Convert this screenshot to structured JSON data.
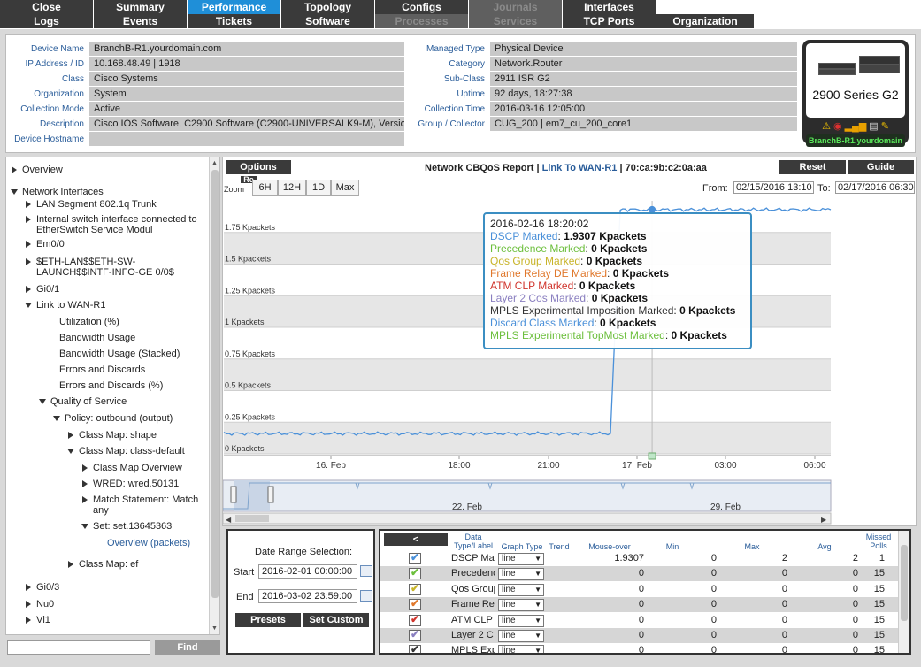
{
  "nav": {
    "row1": [
      {
        "label": "Close",
        "state": "normal"
      },
      {
        "label": "Summary",
        "state": "normal"
      },
      {
        "label": "Performance",
        "state": "active"
      },
      {
        "label": "Topology",
        "state": "normal"
      },
      {
        "label": "Configs",
        "state": "normal"
      },
      {
        "label": "Journals",
        "state": "disabled"
      },
      {
        "label": "Interfaces",
        "state": "normal"
      }
    ],
    "row2": [
      {
        "label": "Logs",
        "state": "normal"
      },
      {
        "label": "Events",
        "state": "normal"
      },
      {
        "label": "Tickets",
        "state": "normal"
      },
      {
        "label": "Software",
        "state": "normal"
      },
      {
        "label": "Processes",
        "state": "disabled"
      },
      {
        "label": "Services",
        "state": "disabled"
      },
      {
        "label": "TCP Ports",
        "state": "normal"
      },
      {
        "label": "Organization",
        "state": "normal"
      }
    ]
  },
  "device": {
    "left": [
      {
        "label": "Device Name",
        "value": "BranchB-R1.yourdomain.com"
      },
      {
        "label": "IP Address / ID",
        "value": "10.168.48.49 | 1918"
      },
      {
        "label": "Class",
        "value": "Cisco Systems"
      },
      {
        "label": "Organization",
        "value": "System"
      },
      {
        "label": "Collection Mode",
        "value": "Active"
      },
      {
        "label": "Description",
        "value": "Cisco IOS Software, C2900 Software (C2900-UNIVERSALK9-M), Version"
      },
      {
        "label": "Device Hostname",
        "value": ""
      }
    ],
    "right": [
      {
        "label": "Managed Type",
        "value": "Physical Device"
      },
      {
        "label": "Category",
        "value": "Network.Router"
      },
      {
        "label": "Sub-Class",
        "value": "2911 ISR G2"
      },
      {
        "label": "Uptime",
        "value": "92 days, 18:27:38"
      },
      {
        "label": "Collection Time",
        "value": "2016-03-16 12:05:00"
      },
      {
        "label": "Group / Collector",
        "value": "CUG_200 | em7_cu_200_core1"
      }
    ],
    "card": {
      "series": "2900 Series G2",
      "name": "BranchB-R1.yourdomain",
      "icons": [
        "warning-icon",
        "lifebuoy-icon",
        "signal-bars-icon",
        "printer-icon",
        "wrench-icon"
      ]
    }
  },
  "tree": {
    "find_label": "Find",
    "items": [
      {
        "label": "Overview",
        "expander": "right"
      },
      {
        "label": "Network Interfaces",
        "expander": "down"
      },
      {
        "label": "LAN Segment 802.1q Trunk",
        "expander": "right"
      },
      {
        "label": "Internal switch interface connected to",
        "label2": "EtherSwitch Service Modul",
        "expander": "right"
      },
      {
        "label": "Em0/0",
        "expander": "right"
      },
      {
        "label": "$ETH-LAN$$ETH-SW-",
        "label2": "LAUNCH$$INTF-INFO-GE 0/0$",
        "expander": "right"
      },
      {
        "label": "Gi0/1",
        "expander": "right"
      },
      {
        "label": "Link to WAN-R1",
        "expander": "down"
      },
      {
        "label": "Utilization (%)",
        "expander": "none"
      },
      {
        "label": "Bandwidth Usage",
        "expander": "none"
      },
      {
        "label": "Bandwidth Usage (Stacked)",
        "expander": "none"
      },
      {
        "label": "Errors and Discards",
        "expander": "none"
      },
      {
        "label": "Errors and Discards (%)",
        "expander": "none"
      },
      {
        "label": "Quality of Service",
        "expander": "down"
      },
      {
        "label": "Policy: outbound (output)",
        "expander": "down"
      },
      {
        "label": "Class Map: shape",
        "expander": "right"
      },
      {
        "label": "Class Map: class-default",
        "expander": "down"
      },
      {
        "label": "Class Map Overview",
        "expander": "right"
      },
      {
        "label": "WRED: wred.50131",
        "expander": "right"
      },
      {
        "label": "Match Statement: Match",
        "label2": "any",
        "expander": "right"
      },
      {
        "label": "Set: set.13645363",
        "expander": "down"
      },
      {
        "label": "Overview (packets)",
        "expander": "none"
      },
      {
        "label": "Class Map: ef",
        "expander": "right"
      },
      {
        "label": "Gi0/3",
        "expander": "right"
      },
      {
        "label": "Nu0",
        "expander": "right"
      },
      {
        "label": "Vl1",
        "expander": "right"
      }
    ]
  },
  "chart": {
    "options_label": "Options",
    "reset_label": "Reset",
    "guide_label": "Guide",
    "title_prefix": "Network CBQoS Report | ",
    "title_link": "Link To WAN-R1",
    "title_suffix": " | 70:ca:9b:c2:0a:aa",
    "zoom_label": "Zoom",
    "overlap_label": "Re",
    "zoom_buttons": [
      "6H",
      "12H",
      "1D",
      "Max"
    ],
    "from_label": "From:",
    "from_value": "02/15/2016 13:10",
    "to_label": "To:",
    "to_value": "02/17/2016 06:30",
    "navigator_ticks": [
      "22. Feb",
      "29. Feb"
    ]
  },
  "chart_data": {
    "type": "line",
    "ylabel_unit": "Kpackets",
    "y_ticks": [
      "0 Kpackets",
      "0.25 Kpackets",
      "0.5 Kpackets",
      "0.75 Kpackets",
      "1 Kpackets",
      "1.25 Kpackets",
      "1.5 Kpackets",
      "1.75 Kpackets"
    ],
    "x_ticks": [
      "16. Feb",
      "18:00",
      "21:00",
      "17. Feb",
      "03:00",
      "06:00"
    ],
    "ylim": [
      0,
      2
    ],
    "grid": true,
    "series": [
      {
        "name": "DSCP Marked",
        "color": "#4a90d9",
        "x": [
          "2016-02-15 13:10",
          "2016-02-15 18:00",
          "2016-02-16 00:00",
          "2016-02-16 06:00",
          "2016-02-16 12:00",
          "2016-02-16 15:30",
          "2016-02-16 16:00",
          "2016-02-16 16:10",
          "2016-02-16 17:00",
          "2016-02-16 18:20",
          "2016-02-16 21:00",
          "2016-02-17 00:00",
          "2016-02-17 03:00",
          "2016-02-17 06:30"
        ],
        "values": [
          0.16,
          0.16,
          0.16,
          0.16,
          0.16,
          0.16,
          1.5,
          1.93,
          1.93,
          1.9307,
          1.93,
          1.93,
          1.93,
          1.93
        ]
      }
    ]
  },
  "tooltip": {
    "time": "2016-02-16 18:20:02",
    "rows": [
      {
        "name": "DSCP Marked",
        "value": "1.9307 Kpackets",
        "color": "#4a90d9"
      },
      {
        "name": "Precedence Marked",
        "value": "0 Kpackets",
        "color": "#6cbf3c"
      },
      {
        "name": "Qos Group Marked",
        "value": "0 Kpackets",
        "color": "#c8b428"
      },
      {
        "name": "Frame Relay DE Marked",
        "value": "0 Kpackets",
        "color": "#e0782c"
      },
      {
        "name": "ATM CLP Marked",
        "value": "0 Kpackets",
        "color": "#d0342c"
      },
      {
        "name": "Layer 2 Cos Marked",
        "value": "0 Kpackets",
        "color": "#8a7fc0"
      },
      {
        "name": "MPLS Experimental Imposition Marked",
        "value": "0 Kpackets",
        "color": "#333333"
      },
      {
        "name": "Discard Class Marked",
        "value": "0 Kpackets",
        "color": "#4a90d9"
      },
      {
        "name": "MPLS Experimental TopMost Marked",
        "value": "0 Kpackets",
        "color": "#6cbf3c"
      }
    ]
  },
  "daterange": {
    "title": "Date Range Selection:",
    "start_label": "Start",
    "start_value": "2016-02-01 00:00:00",
    "end_label": "End",
    "end_value": "2016-03-02 23:59:00",
    "presets_label": "Presets",
    "setcustom_label": "Set Custom"
  },
  "table": {
    "back_label": "<",
    "headers": {
      "datatype": "Data Type/Label",
      "graphtype": "Graph Type",
      "trend": "Trend",
      "mouseover": "Mouse-over",
      "min": "Min",
      "max": "Max",
      "avg": "Avg",
      "missed": "Missed Polls"
    },
    "rows": [
      {
        "label": "DSCP Ma",
        "graph": "line",
        "mouseover": "1.9307",
        "min": "0",
        "max": "2",
        "avg": "2",
        "missed": "1",
        "color": "#4a90d9"
      },
      {
        "label": "Precedence",
        "graph": "line",
        "mouseover": "0",
        "min": "0",
        "max": "0",
        "avg": "0",
        "missed": "15",
        "color": "#6cbf3c"
      },
      {
        "label": "Qos Group",
        "graph": "line",
        "mouseover": "0",
        "min": "0",
        "max": "0",
        "avg": "0",
        "missed": "15",
        "color": "#c8b428"
      },
      {
        "label": "Frame Re",
        "graph": "line",
        "mouseover": "0",
        "min": "0",
        "max": "0",
        "avg": "0",
        "missed": "15",
        "color": "#e0782c"
      },
      {
        "label": "ATM CLP",
        "graph": "line",
        "mouseover": "0",
        "min": "0",
        "max": "0",
        "avg": "0",
        "missed": "15",
        "color": "#d0342c"
      },
      {
        "label": "Layer 2 C",
        "graph": "line",
        "mouseover": "0",
        "min": "0",
        "max": "0",
        "avg": "0",
        "missed": "15",
        "color": "#8a7fc0"
      },
      {
        "label": "MPLS Exp",
        "graph": "line",
        "mouseover": "0",
        "min": "0",
        "max": "0",
        "avg": "0",
        "missed": "15",
        "color": "#333333"
      }
    ]
  }
}
